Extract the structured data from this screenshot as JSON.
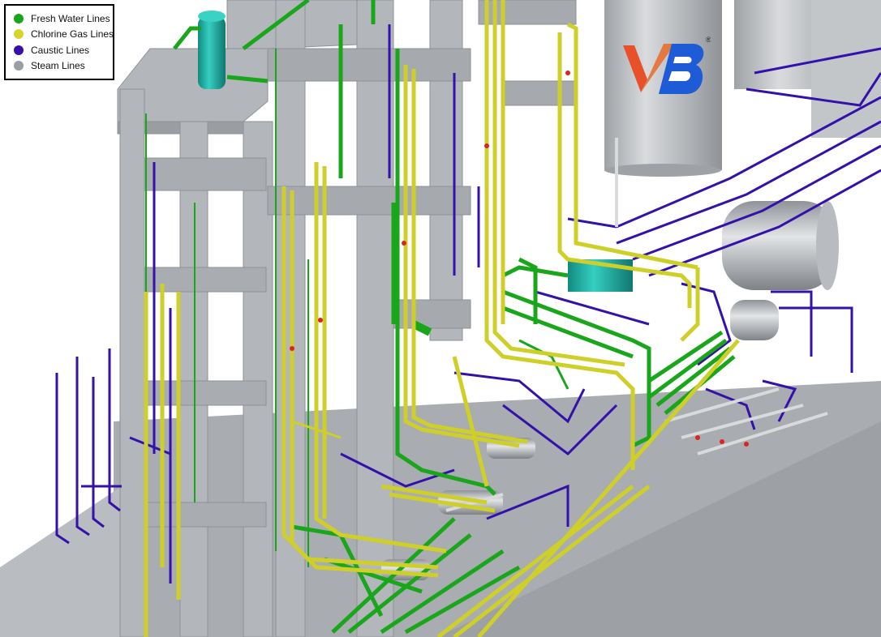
{
  "legend": {
    "items": [
      {
        "label": "Fresh Water Lines",
        "color": "#1aa61a",
        "icon": "green-dot-icon"
      },
      {
        "label": "Chlorine Gas Lines",
        "color": "#d6d62a",
        "icon": "yellow-dot-icon"
      },
      {
        "label": "Caustic Lines",
        "color": "#3311aa",
        "icon": "purple-dot-icon"
      },
      {
        "label": "Steam Lines",
        "color": "#9a9ea3",
        "icon": "gray-dot-icon"
      }
    ]
  },
  "logo": {
    "text": "VB",
    "mark": "®"
  },
  "colors": {
    "structure": "#b3b6ba",
    "structure_dark": "#8e9297",
    "slab": "#a6a9ad",
    "vessel": "#c9cbce",
    "teal": "#1bb3a6",
    "logo_orange": "#e8502a",
    "logo_blue": "#1e5bd6"
  }
}
